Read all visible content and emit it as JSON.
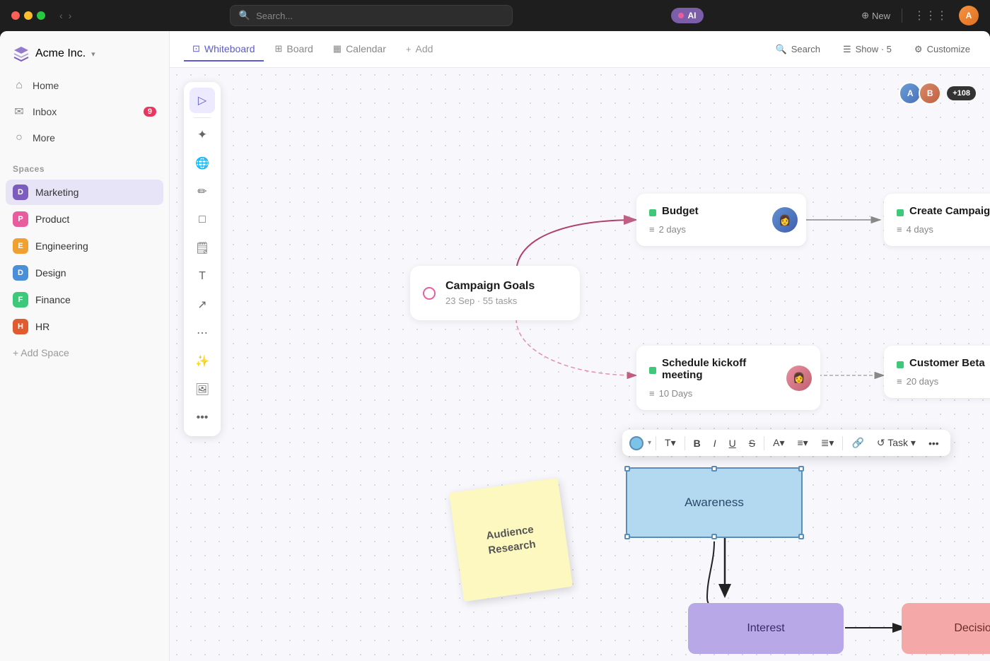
{
  "titlebar": {
    "search_placeholder": "Search...",
    "ai_label": "AI",
    "new_label": "New"
  },
  "sidebar": {
    "logo": "Acme Inc.",
    "nav_items": [
      {
        "id": "home",
        "label": "Home",
        "icon": "⌂"
      },
      {
        "id": "inbox",
        "label": "Inbox",
        "icon": "✉",
        "badge": "9"
      },
      {
        "id": "more",
        "label": "More",
        "icon": "○"
      }
    ],
    "spaces_title": "Spaces",
    "spaces": [
      {
        "id": "marketing",
        "label": "Marketing",
        "letter": "D",
        "color": "badge-marketing",
        "active": true
      },
      {
        "id": "product",
        "label": "Product",
        "letter": "P",
        "color": "badge-product"
      },
      {
        "id": "engineering",
        "label": "Engineering",
        "letter": "E",
        "color": "badge-engineering"
      },
      {
        "id": "design",
        "label": "Design",
        "letter": "D",
        "color": "badge-design"
      },
      {
        "id": "finance",
        "label": "Finance",
        "letter": "F",
        "color": "badge-finance"
      },
      {
        "id": "hr",
        "label": "HR",
        "letter": "H",
        "color": "badge-hr"
      }
    ],
    "add_space_label": "+ Add Space"
  },
  "topnav": {
    "tabs": [
      {
        "id": "whiteboard",
        "label": "Whiteboard",
        "icon": "⊡",
        "active": true
      },
      {
        "id": "board",
        "label": "Board",
        "icon": "⊞"
      },
      {
        "id": "calendar",
        "label": "Calendar",
        "icon": "📅"
      },
      {
        "id": "add",
        "label": "Add",
        "icon": "+"
      }
    ],
    "right_buttons": [
      {
        "id": "search",
        "label": "Search",
        "icon": "🔍"
      },
      {
        "id": "show",
        "label": "Show · 5",
        "icon": "☰"
      },
      {
        "id": "customize",
        "label": "Customize",
        "icon": "⚙"
      }
    ],
    "avatars_count": "+108"
  },
  "whiteboard": {
    "cards": {
      "budget": {
        "title": "Budget",
        "days": "2 days",
        "avatar_color": "#4a80c4"
      },
      "create_campaign": {
        "title": "Create Campaign",
        "days": "4 days",
        "avatar_color": "#e8a030"
      },
      "campaign_goals": {
        "title": "Campaign Goals",
        "date": "23 Sep",
        "tasks": "55 tasks"
      },
      "schedule_kickoff": {
        "title": "Schedule kickoff meeting",
        "days": "10 Days"
      },
      "customer_beta": {
        "title": "Customer Beta",
        "days": "20 days"
      }
    },
    "sticky": {
      "text": "Audience Research"
    },
    "awareness": {
      "text": "Awareness"
    },
    "interest": {
      "text": "Interest"
    },
    "decision": {
      "text": "Decision"
    },
    "format_toolbar": {
      "buttons": [
        "T",
        "B",
        "I",
        "U",
        "S̶",
        "A",
        "≡",
        "≡≡",
        "🔗",
        "↺",
        "Task",
        "..."
      ]
    }
  }
}
